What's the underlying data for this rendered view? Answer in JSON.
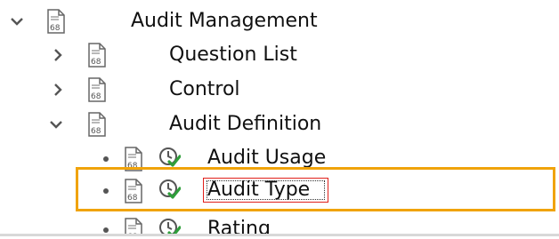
{
  "tree": {
    "root": {
      "label": "Audit Management",
      "icon": "document-icon",
      "state": "expanded"
    },
    "items": [
      {
        "label": "Question List",
        "state": "collapsed"
      },
      {
        "label": "Control",
        "state": "collapsed"
      },
      {
        "label": "Audit Definition",
        "state": "expanded"
      }
    ],
    "leaves": [
      {
        "label": "Audit Usage",
        "icon": "clock-check-icon"
      },
      {
        "label": "Audit Type",
        "icon": "clock-check-icon",
        "selected": true
      },
      {
        "label": "Rating",
        "icon": "clock-check-icon"
      }
    ]
  },
  "colors": {
    "highlight": "#f0a30a",
    "focus_border": "#e0201a",
    "check": "#2e9e3a"
  }
}
